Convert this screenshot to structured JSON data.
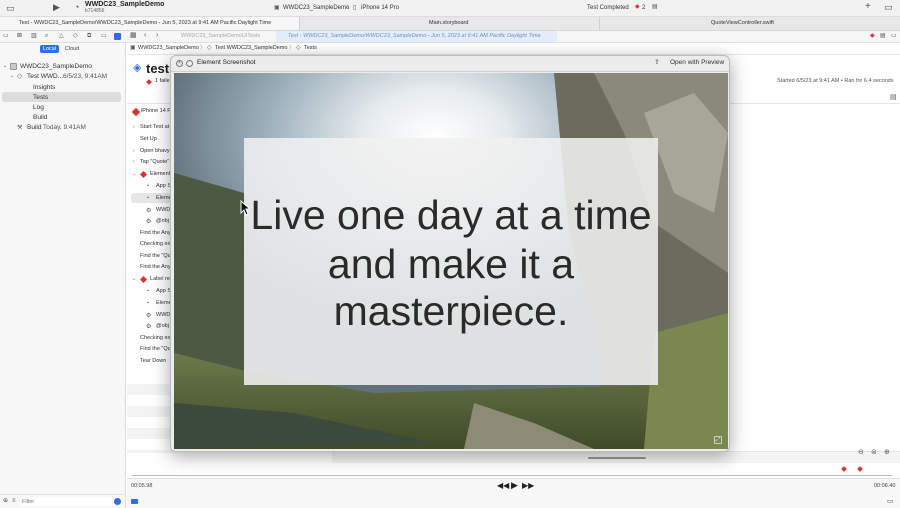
{
  "window": {
    "project_name": "WWDC23_SampleDemo",
    "project_sub": "b714856",
    "scheme": "WWDC23_SampleDemo",
    "device": "iPhone 14 Pro",
    "status": "Test Completed",
    "error_count": "2"
  },
  "tabs": [
    {
      "label": "Test - WWDC23_SampleDemo/WWDC23_SampleDemo - Jun 5, 2023 at 9:41 AM Pacific Daylight Time"
    },
    {
      "label": "Main.storyboard"
    },
    {
      "label": "QuoteViewController.swift"
    }
  ],
  "pathbar": {
    "left": "WWDC23_SampleDemoUITests",
    "right": "Test - WWDC23_SampleDemo/WWDC23_SampleDemo - Jun 5, 2023 at 9:41 AM Pacific Daylight Time"
  },
  "sidebar": {
    "segments": {
      "local": "Local",
      "cloud": "Cloud"
    },
    "tree": [
      {
        "label": "WWDC23_SampleDemo"
      },
      {
        "label": "Test WWD...",
        "date": "6/5/23, 9:41AM"
      },
      {
        "label": "Insights"
      },
      {
        "label": "Tests"
      },
      {
        "label": "Log"
      },
      {
        "label": "Build"
      },
      {
        "label": "Build",
        "date": "Today, 9:41AM"
      }
    ],
    "filter_placeholder": "Filter"
  },
  "editor": {
    "breadcrumb": [
      "WWDC23_SampleDemo",
      "Test WWDC23_SampleDemo",
      "Tests"
    ],
    "title": "test",
    "failed": "1 faile",
    "started": "Started 6/5/23 at 9:41 AM • Ran for 6.4 seconds",
    "device_row": "iPhone 14 P",
    "steps": [
      {
        "label": "Start Test at"
      },
      {
        "label": "Set Up"
      },
      {
        "label": "Open bhavy"
      },
      {
        "label": "Tap \"Quote\""
      },
      {
        "label": "Element"
      },
      {
        "label": "App S"
      },
      {
        "label": "Eleme"
      },
      {
        "label": "WWD"
      },
      {
        "label": "@obj"
      },
      {
        "label": "Find the Any"
      },
      {
        "label": "Checking ex"
      },
      {
        "label": "Find the \"Qu"
      },
      {
        "label": "Find the Any"
      },
      {
        "label": "Label re"
      },
      {
        "label": "App S"
      },
      {
        "label": "Eleme"
      },
      {
        "label": "WWD"
      },
      {
        "label": "@obj"
      },
      {
        "label": "Checking ex"
      },
      {
        "label": "Find the \"Qu"
      },
      {
        "label": "Tear Down"
      }
    ]
  },
  "timeline": {
    "start": "00:05.98",
    "end": "00:06.40"
  },
  "modal": {
    "title": "Element Screenshot",
    "open_with": "Open with Preview",
    "quote_lines": [
      "Live one day at a time",
      "and make it a",
      "masterpiece."
    ]
  },
  "colors": {
    "accent": "#2f6ee6",
    "error": "#e03030"
  }
}
